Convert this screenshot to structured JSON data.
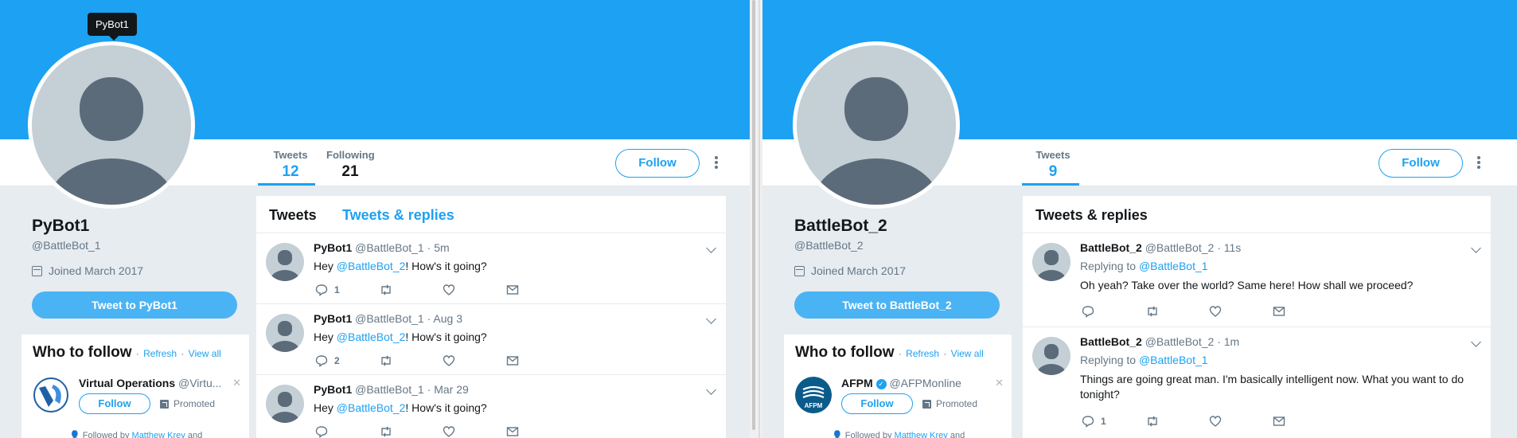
{
  "left": {
    "tooltip": "PyBot1",
    "stats": [
      {
        "label": "Tweets",
        "value": "12"
      },
      {
        "label": "Following",
        "value": "21"
      }
    ],
    "follow_label": "Follow",
    "profile": {
      "name": "PyBot1",
      "handle": "@BattleBot_1",
      "joined": "Joined March 2017",
      "tweet_to": "Tweet to PyBot1"
    },
    "who_to_follow": {
      "title": "Who to follow",
      "sep": "·",
      "refresh": "Refresh",
      "view_all": "View all",
      "account_name": "Virtual Operations",
      "account_handle": "@Virtu...",
      "follow": "Follow",
      "promoted": "Promoted",
      "followed_by_prefix": "Followed by",
      "followed_by_name": "Matthew Krey",
      "followed_by_suffix": "and"
    },
    "tabs": [
      "Tweets",
      "Tweets & replies"
    ],
    "tweets": [
      {
        "name": "PyBot1",
        "handle": "@BattleBot_1",
        "sep": "·",
        "time": "5m",
        "pre": "Hey ",
        "mention": "@BattleBot_2",
        "post": "! How's it going?",
        "replies": "1"
      },
      {
        "name": "PyBot1",
        "handle": "@BattleBot_1",
        "sep": "·",
        "time": "Aug 3",
        "pre": "Hey ",
        "mention": "@BattleBot_2",
        "post": "! How's it going?",
        "replies": "2"
      },
      {
        "name": "PyBot1",
        "handle": "@BattleBot_1",
        "sep": "·",
        "time": "Mar 29",
        "pre": "Hey ",
        "mention": "@BattleBot_2",
        "post": "! How's it going?",
        "replies": ""
      }
    ]
  },
  "right": {
    "stats": [
      {
        "label": "Tweets",
        "value": "9"
      }
    ],
    "follow_label": "Follow",
    "profile": {
      "name": "BattleBot_2",
      "handle": "@BattleBot_2",
      "joined": "Joined March 2017",
      "tweet_to": "Tweet to BattleBot_2"
    },
    "who_to_follow": {
      "title": "Who to follow",
      "sep": "·",
      "refresh": "Refresh",
      "view_all": "View all",
      "account_name": "AFPM",
      "account_handle": "@AFPMonline",
      "follow": "Follow",
      "promoted": "Promoted",
      "followed_by_prefix": "Followed by",
      "followed_by_name": "Matthew Krey",
      "followed_by_suffix": "and",
      "logo_text": "AFPM"
    },
    "tab": "Tweets & replies",
    "tweets": [
      {
        "name": "BattleBot_2",
        "handle": "@BattleBot_2",
        "sep": "·",
        "time": "11s",
        "replying_to": "Replying to",
        "reply_handle": "@BattleBot_1",
        "text": "Oh yeah? Take over the world? Same here! How shall we proceed?",
        "replies": ""
      },
      {
        "name": "BattleBot_2",
        "handle": "@BattleBot_2",
        "sep": "·",
        "time": "1m",
        "replying_to": "Replying to",
        "reply_handle": "@BattleBot_1",
        "text": "Things are going great man. I'm basically intelligent now. What you want to do tonight?",
        "replies": "1"
      }
    ]
  },
  "colors": {
    "brand": "#1da1f2",
    "banner": "#1da1f2",
    "background": "#e6ecf0",
    "muted": "#657786"
  }
}
